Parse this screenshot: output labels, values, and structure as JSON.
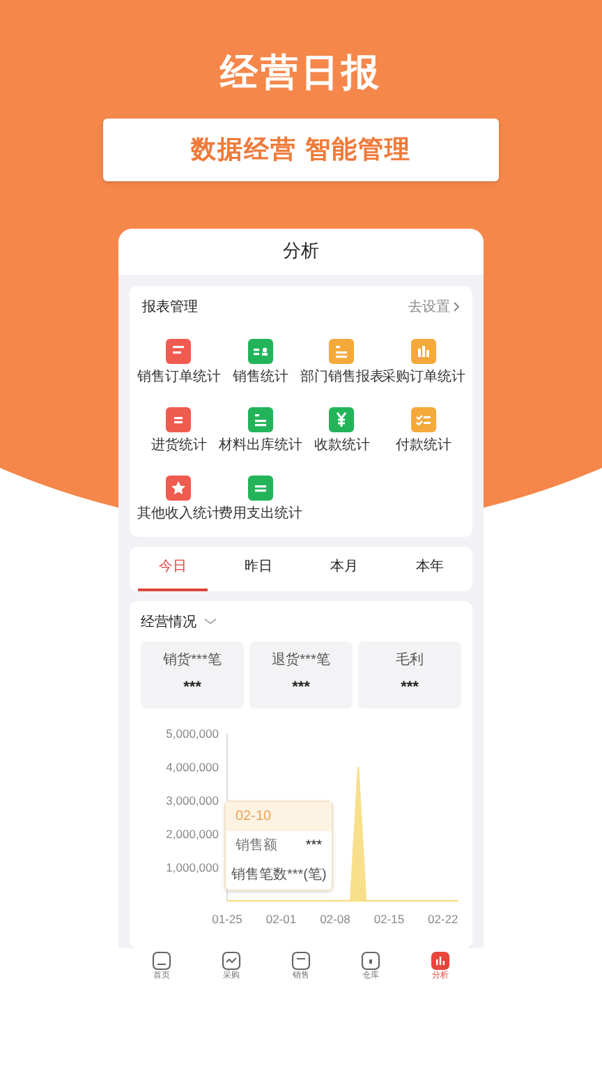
{
  "headline": "经营日报",
  "slogan": "数据经营 智能管理",
  "screen_title": "分析",
  "reports": {
    "title": "报表管理",
    "settings_link": "去设置",
    "items": [
      {
        "label": "销售订单统计",
        "color": "#ef5b4f",
        "kind": "doc"
      },
      {
        "label": "销售统计",
        "color": "#23b45a",
        "kind": "calendar"
      },
      {
        "label": "部门销售报表",
        "color": "#f5a93a",
        "kind": "list"
      },
      {
        "label": "采购订单统计",
        "color": "#f5a93a",
        "kind": "bars"
      },
      {
        "label": "进货统计",
        "color": "#ef5b4f",
        "kind": "ticket"
      },
      {
        "label": "材料出库统计",
        "color": "#23b45a",
        "kind": "list"
      },
      {
        "label": "收款统计",
        "color": "#23b45a",
        "kind": "yen"
      },
      {
        "label": "付款统计",
        "color": "#f5a93a",
        "kind": "check"
      },
      {
        "label": "其他收入统计",
        "color": "#ef5b4f",
        "kind": "star"
      },
      {
        "label": "费用支出统计",
        "color": "#23b45a",
        "kind": "clipboard"
      }
    ]
  },
  "periods": [
    {
      "label": "今日",
      "selected": true
    },
    {
      "label": "昨日",
      "selected": false
    },
    {
      "label": "本月",
      "selected": false
    },
    {
      "label": "本年",
      "selected": false
    }
  ],
  "overview": {
    "title": "经营情况",
    "stats": [
      {
        "label": "销货***笔",
        "value": "***"
      },
      {
        "label": "退货***笔",
        "value": "***"
      },
      {
        "label": "毛利",
        "value": "***"
      }
    ],
    "chart_data": {
      "type": "area",
      "categories": [
        "01-25",
        null,
        null,
        null,
        null,
        null,
        null,
        "02-01",
        null,
        null,
        null,
        null,
        null,
        null,
        "02-08",
        null,
        null,
        null,
        null,
        null,
        null,
        "02-15",
        null,
        null,
        null,
        null,
        null,
        null,
        "02-22",
        null,
        null
      ],
      "series": [
        {
          "color": "#f8df8c",
          "values": [
            0,
            0,
            0,
            0,
            0,
            0,
            0,
            0,
            0,
            0,
            0,
            0,
            0,
            0,
            0,
            0,
            0,
            4000000,
            0,
            0,
            0,
            0,
            0,
            0,
            0,
            0,
            0,
            0,
            0,
            0,
            0
          ]
        }
      ],
      "ylim": [
        0,
        5000000
      ],
      "yticks": [
        {
          "value": 1000000,
          "label": "1,000,000"
        },
        {
          "value": 2000000,
          "label": "2,000,000"
        },
        {
          "value": 3000000,
          "label": "3,000,000"
        },
        {
          "value": 4000000,
          "label": "4,000,000"
        },
        {
          "value": 5000000,
          "label": "5,000,000"
        }
      ]
    },
    "tooltip": {
      "date": "02-10",
      "rows": [
        {
          "label": "销售额",
          "value": "***"
        }
      ],
      "count": "销售笔数***(笔)"
    }
  },
  "nav": [
    {
      "label": "首页",
      "selected": false
    },
    {
      "label": "采购",
      "selected": false
    },
    {
      "label": "销售",
      "selected": false
    },
    {
      "label": "仓库",
      "selected": false
    },
    {
      "label": "分析",
      "selected": true
    }
  ]
}
